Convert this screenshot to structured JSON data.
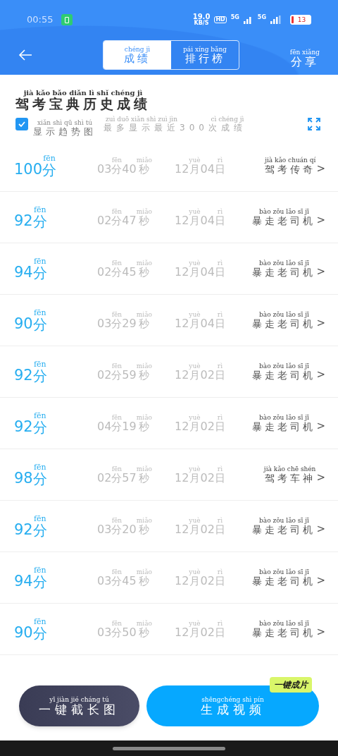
{
  "status_bar": {
    "time": "00:55",
    "speed": "19.0",
    "speed_unit": "KB/S",
    "hd": "HD",
    "network_1": "5G",
    "network_2": "5G",
    "battery": "13"
  },
  "header": {
    "tabs": [
      {
        "label": "成绩",
        "pinyin": "chéng jì",
        "selected": true
      },
      {
        "label": "排行榜",
        "pinyin": "pái xíng bǎng",
        "selected": false
      }
    ],
    "share": {
      "label": "分享",
      "pinyin": "fēn xiǎng"
    }
  },
  "title": {
    "text": "驾考宝典历史成绩",
    "pinyin": "jià kǎo bǎo diǎn lì shǐ chéng jì"
  },
  "trend": {
    "checked": true,
    "label": {
      "text": "显示趋势图",
      "pinyin": "xiǎn shì qū shì tú"
    },
    "note": [
      {
        "text": "最多显示最近",
        "pinyin": "zuì duō xiǎn shì zuì jìn"
      },
      {
        "text": "300"
      },
      {
        "text": "次成绩",
        "pinyin": "cì chéng jì"
      }
    ]
  },
  "records": [
    {
      "score": "100",
      "score_unit": {
        "text": "分",
        "pinyin": "fēn"
      },
      "time_min": "03",
      "min_unit": {
        "text": "分",
        "pinyin": "fēn"
      },
      "time_sec": "40",
      "sec_unit": {
        "text": "秒",
        "pinyin": "miǎo"
      },
      "month": "12",
      "month_unit": {
        "text": "月",
        "pinyin": "yuè"
      },
      "day": "04",
      "day_unit": {
        "text": "日",
        "pinyin": "rì"
      },
      "title": {
        "text": "驾考传奇",
        "pinyin": "jià kǎo chuán qí"
      },
      "arrow": ">"
    },
    {
      "score": "92",
      "score_unit": {
        "text": "分",
        "pinyin": "fēn"
      },
      "time_min": "02",
      "min_unit": {
        "text": "分",
        "pinyin": "fēn"
      },
      "time_sec": "47",
      "sec_unit": {
        "text": "秒",
        "pinyin": "miǎo"
      },
      "month": "12",
      "month_unit": {
        "text": "月",
        "pinyin": "yuè"
      },
      "day": "04",
      "day_unit": {
        "text": "日",
        "pinyin": "rì"
      },
      "title": {
        "text": "暴走老司机",
        "pinyin": "bào zǒu lǎo sī jī"
      },
      "arrow": ">"
    },
    {
      "score": "94",
      "score_unit": {
        "text": "分",
        "pinyin": "fēn"
      },
      "time_min": "02",
      "min_unit": {
        "text": "分",
        "pinyin": "fēn"
      },
      "time_sec": "45",
      "sec_unit": {
        "text": "秒",
        "pinyin": "miǎo"
      },
      "month": "12",
      "month_unit": {
        "text": "月",
        "pinyin": "yuè"
      },
      "day": "04",
      "day_unit": {
        "text": "日",
        "pinyin": "rì"
      },
      "title": {
        "text": "暴走老司机",
        "pinyin": "bào zǒu lǎo sī jī"
      },
      "arrow": ">"
    },
    {
      "score": "90",
      "score_unit": {
        "text": "分",
        "pinyin": "fēn"
      },
      "time_min": "03",
      "min_unit": {
        "text": "分",
        "pinyin": "fēn"
      },
      "time_sec": "29",
      "sec_unit": {
        "text": "秒",
        "pinyin": "miǎo"
      },
      "month": "12",
      "month_unit": {
        "text": "月",
        "pinyin": "yuè"
      },
      "day": "04",
      "day_unit": {
        "text": "日",
        "pinyin": "rì"
      },
      "title": {
        "text": "暴走老司机",
        "pinyin": "bào zǒu lǎo sī jī"
      },
      "arrow": ">"
    },
    {
      "score": "92",
      "score_unit": {
        "text": "分",
        "pinyin": "fēn"
      },
      "time_min": "02",
      "min_unit": {
        "text": "分",
        "pinyin": "fēn"
      },
      "time_sec": "59",
      "sec_unit": {
        "text": "秒",
        "pinyin": "miǎo"
      },
      "month": "12",
      "month_unit": {
        "text": "月",
        "pinyin": "yuè"
      },
      "day": "02",
      "day_unit": {
        "text": "日",
        "pinyin": "rì"
      },
      "title": {
        "text": "暴走老司机",
        "pinyin": "bào zǒu lǎo sī jī"
      },
      "arrow": ">"
    },
    {
      "score": "92",
      "score_unit": {
        "text": "分",
        "pinyin": "fēn"
      },
      "time_min": "04",
      "min_unit": {
        "text": "分",
        "pinyin": "fēn"
      },
      "time_sec": "19",
      "sec_unit": {
        "text": "秒",
        "pinyin": "miǎo"
      },
      "month": "12",
      "month_unit": {
        "text": "月",
        "pinyin": "yuè"
      },
      "day": "02",
      "day_unit": {
        "text": "日",
        "pinyin": "rì"
      },
      "title": {
        "text": "暴走老司机",
        "pinyin": "bào zǒu lǎo sī jī"
      },
      "arrow": ">"
    },
    {
      "score": "98",
      "score_unit": {
        "text": "分",
        "pinyin": "fēn"
      },
      "time_min": "02",
      "min_unit": {
        "text": "分",
        "pinyin": "fēn"
      },
      "time_sec": "57",
      "sec_unit": {
        "text": "秒",
        "pinyin": "miǎo"
      },
      "month": "12",
      "month_unit": {
        "text": "月",
        "pinyin": "yuè"
      },
      "day": "02",
      "day_unit": {
        "text": "日",
        "pinyin": "rì"
      },
      "title": {
        "text": "驾考车神",
        "pinyin": "jià kǎo chē shén"
      },
      "arrow": ">"
    },
    {
      "score": "92",
      "score_unit": {
        "text": "分",
        "pinyin": "fēn"
      },
      "time_min": "03",
      "min_unit": {
        "text": "分",
        "pinyin": "fēn"
      },
      "time_sec": "20",
      "sec_unit": {
        "text": "秒",
        "pinyin": "miǎo"
      },
      "month": "12",
      "month_unit": {
        "text": "月",
        "pinyin": "yuè"
      },
      "day": "02",
      "day_unit": {
        "text": "日",
        "pinyin": "rì"
      },
      "title": {
        "text": "暴走老司机",
        "pinyin": "bào zǒu lǎo sī jī"
      },
      "arrow": ">"
    },
    {
      "score": "94",
      "score_unit": {
        "text": "分",
        "pinyin": "fēn"
      },
      "time_min": "03",
      "min_unit": {
        "text": "分",
        "pinyin": "fēn"
      },
      "time_sec": "45",
      "sec_unit": {
        "text": "秒",
        "pinyin": "miǎo"
      },
      "month": "12",
      "month_unit": {
        "text": "月",
        "pinyin": "yuè"
      },
      "day": "02",
      "day_unit": {
        "text": "日",
        "pinyin": "rì"
      },
      "title": {
        "text": "暴走老司机",
        "pinyin": "bào zǒu lǎo sī jī"
      },
      "arrow": ">"
    },
    {
      "score": "90",
      "score_unit": {
        "text": "分",
        "pinyin": "fēn"
      },
      "time_min": "03",
      "min_unit": {
        "text": "分",
        "pinyin": "fēn"
      },
      "time_sec": "50",
      "sec_unit": {
        "text": "秒",
        "pinyin": "miǎo"
      },
      "month": "12",
      "month_unit": {
        "text": "月",
        "pinyin": "yuè"
      },
      "day": "02",
      "day_unit": {
        "text": "日",
        "pinyin": "rì"
      },
      "title": {
        "text": "暴走老司机",
        "pinyin": "bào zǒu lǎo sī jī"
      },
      "arrow": ">"
    }
  ],
  "buttons": {
    "screenshot": {
      "label": "一键截长图",
      "pinyin": "yī jiàn jié cháng tú"
    },
    "video": {
      "label": "生成视频",
      "pinyin": "shēngchéng shì pín"
    },
    "video_badge": "一键成片"
  }
}
